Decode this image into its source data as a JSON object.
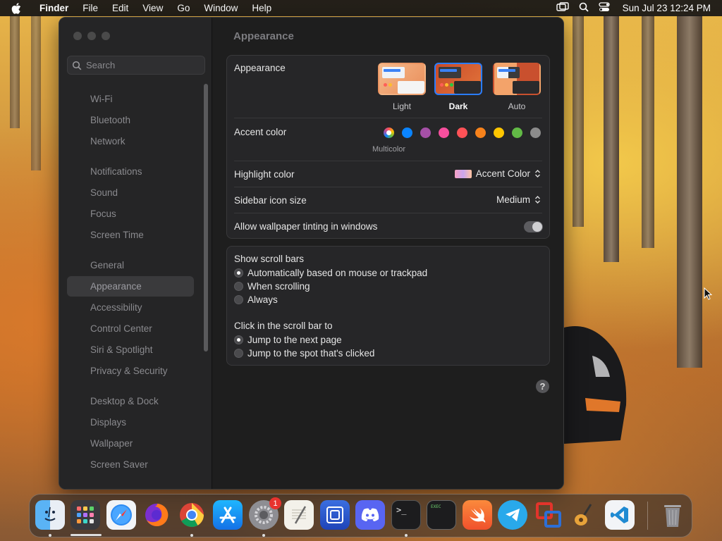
{
  "menubar": {
    "app": "Finder",
    "menus": [
      "File",
      "Edit",
      "View",
      "Go",
      "Window",
      "Help"
    ],
    "clock": "Sun Jul 23  12:24 PM"
  },
  "window": {
    "search": {
      "placeholder": "Search",
      "value": ""
    },
    "sidebar": {
      "items": [
        "Wi-Fi",
        "Bluetooth",
        "Network",
        "Notifications",
        "Sound",
        "Focus",
        "Screen Time",
        "General",
        "Appearance",
        "Accessibility",
        "Control Center",
        "Siri & Spotlight",
        "Privacy & Security",
        "Desktop & Dock",
        "Displays",
        "Wallpaper",
        "Screen Saver"
      ],
      "selected": "Appearance"
    },
    "title": "Appearance",
    "appearance": {
      "label": "Appearance",
      "options": [
        "Light",
        "Dark",
        "Auto"
      ],
      "selected": "Dark"
    },
    "accent": {
      "label": "Accent color",
      "selected_label": "Multicolor",
      "colors": [
        "#0a84ff",
        "#a550a7",
        "#f74f9e",
        "#ff5257",
        "#f7821b",
        "#ffc600",
        "#62ba46",
        "#8c8c8c"
      ]
    },
    "highlight": {
      "label": "Highlight color",
      "value": "Accent Color"
    },
    "sidebar_icon": {
      "label": "Sidebar icon size",
      "value": "Medium"
    },
    "tinting": {
      "label": "Allow wallpaper tinting in windows",
      "on": false
    },
    "scrollbars": {
      "label": "Show scroll bars",
      "options": [
        "Automatically based on mouse or trackpad",
        "When scrolling",
        "Always"
      ],
      "selected": "Automatically based on mouse or trackpad"
    },
    "click_scroll": {
      "label": "Click in the scroll bar to",
      "options": [
        "Jump to the next page",
        "Jump to the spot that's clicked"
      ],
      "selected": "Jump to the next page"
    },
    "help": "?"
  },
  "dock": {
    "apps": [
      "finder-icon",
      "launchpad-icon",
      "safari-icon",
      "firefox-icon",
      "chrome-icon",
      "app-store-icon",
      "system-settings-icon",
      "textedit-icon",
      "screen-sharing-icon",
      "discord-icon",
      "terminal-icon",
      "console-icon",
      "swift-icon",
      "telegram-icon",
      "parallels-icon",
      "garageband-icon",
      "vscode-icon",
      "trash-icon"
    ],
    "settings_badge": "1",
    "terminal_prompt": ">_",
    "console_label": "EXEC"
  }
}
